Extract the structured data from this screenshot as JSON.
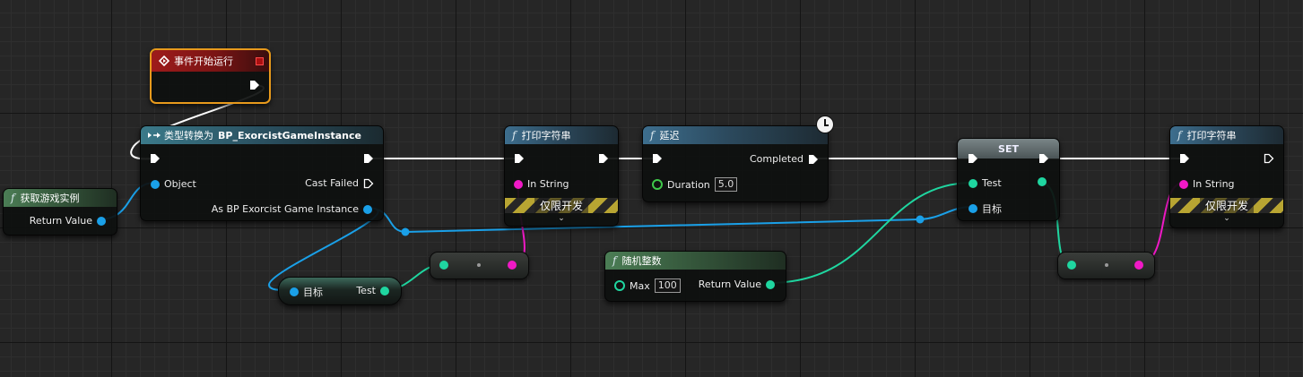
{
  "nodes": {
    "event_begin_play": {
      "title": "事件开始运行"
    },
    "get_game_instance": {
      "title": "获取游戏实例",
      "pins": {
        "return_value": "Return Value"
      }
    },
    "cast": {
      "title_prefix": "类型转换为",
      "title_target": "BP_ExorcistGameInstance",
      "pins": {
        "object": "Object",
        "cast_failed": "Cast Failed",
        "as_instance": "As BP Exorcist Game Instance"
      }
    },
    "get_test": {
      "pins": {
        "target": "目标",
        "test": "Test"
      }
    },
    "print_string_1": {
      "title": "打印字符串",
      "pins": {
        "in_string": "In String"
      },
      "dev_only": "仅限开发"
    },
    "delay": {
      "title": "延迟",
      "pins": {
        "duration": "Duration",
        "duration_value": "5.0",
        "completed": "Completed"
      }
    },
    "random_integer": {
      "title": "随机整数",
      "pins": {
        "max": "Max",
        "max_value": "100",
        "return_value": "Return Value"
      }
    },
    "set_var": {
      "title": "SET",
      "pins": {
        "test": "Test",
        "target": "目标"
      }
    },
    "print_string_2": {
      "title": "打印字符串",
      "pins": {
        "in_string": "In String"
      },
      "dev_only": "仅限开发"
    }
  },
  "icons": {
    "function": "f",
    "event": "diamond-arrow",
    "exec": "triangle-arrow",
    "delay": "clock",
    "dropdown": "chevron-down"
  },
  "colors": {
    "object_pin": "#1aa0e8",
    "string_pin": "#f019c6",
    "integer_pin": "#1fd6a0",
    "float_pin": "#3fc84a",
    "exec_wire": "#ffffff",
    "event_header": "#9e1b1b",
    "function_header": "#3d6e8e",
    "pure_header": "#4b7d55"
  }
}
